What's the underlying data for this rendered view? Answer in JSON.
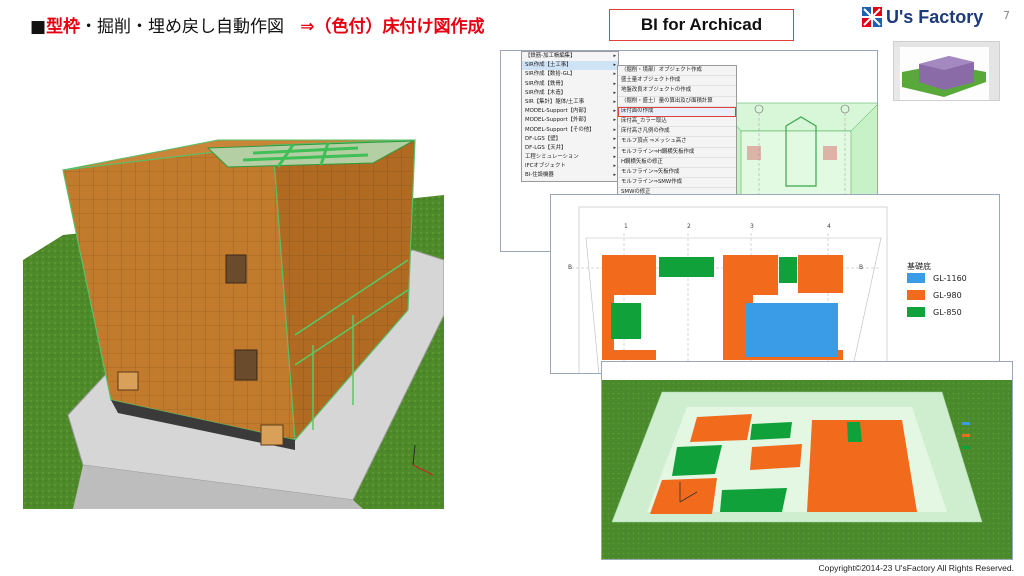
{
  "header": {
    "bullet": "■",
    "title_red_1": "型枠",
    "title_black": "・掘削・埋め戻し自動作図",
    "title_arrow": "⇒",
    "title_red_2": "（色付）床付け図作成",
    "tag": "BI for Archicad",
    "logo_text": "U's Factory",
    "page_number": "7"
  },
  "menu": {
    "items": [
      {
        "label": "【鉄筋-加工帳編集】",
        "arrow": true
      },
      {
        "label": "SIR作成【土工事】",
        "arrow": true,
        "selected": true
      },
      {
        "label": "SIR作成【数拾-GL】",
        "arrow": true
      },
      {
        "label": "SIR作成【鉄骨】",
        "arrow": true
      },
      {
        "label": "SIR作成【木造】",
        "arrow": true
      },
      {
        "label": "SIR【集計】躯体/土工事",
        "arrow": true
      },
      {
        "label": "MODEL-Support【内部】",
        "arrow": true
      },
      {
        "label": "MODEL-Support【外部】",
        "arrow": true
      },
      {
        "label": "MODEL-Support【その他】",
        "arrow": true
      },
      {
        "label": "DF-LGS【壁】",
        "arrow": true
      },
      {
        "label": "DF-LGS【天井】",
        "arrow": true
      },
      {
        "label": "工程シミュレーション",
        "arrow": true
      },
      {
        "label": "IFCオブジェクト",
        "arrow": true
      },
      {
        "label": "BI-住設機器",
        "arrow": true
      }
    ],
    "submenu": [
      {
        "label": "（掘削・境部）オブジェクト作成"
      },
      {
        "label": "盛土量オブジェクト作成"
      },
      {
        "label": "地盤改良オブジェクトの作成"
      },
      {
        "label": "（掘削・盛土）量の算出及び面積計算"
      },
      {
        "label": "床付面の作成",
        "highlight": true
      },
      {
        "label": "床付高_カラー取込"
      },
      {
        "label": "床付高さ凡例の作成"
      },
      {
        "label": "モルフ頂点 ⇒メッシュ高さ"
      },
      {
        "label": "モルフライン⇒H鋼横矢板作成"
      },
      {
        "label": "H鋼横矢板の修正"
      },
      {
        "label": "モルフライン⇒矢板作成"
      },
      {
        "label": "モルフライン⇒SMW作成"
      },
      {
        "label": "SMWの修正"
      }
    ]
  },
  "plan": {
    "legend_title": "基礎底",
    "legend": [
      {
        "label": "GL-1160",
        "color": "#3a9be6"
      },
      {
        "label": "GL-980",
        "color": "#f26b1d"
      },
      {
        "label": "GL-850",
        "color": "#11a13a"
      }
    ],
    "grid_top": [
      "1",
      "2",
      "3",
      "4"
    ],
    "grid_side": [
      "B",
      "B",
      "A"
    ]
  },
  "footer": {
    "copyright": "Copyright©2014-23  U'sFactory All Rights Reserved."
  }
}
